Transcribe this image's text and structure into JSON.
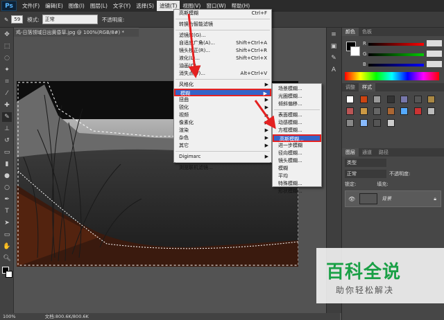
{
  "menubar": {
    "logo": "Ps",
    "items": [
      "文件(F)",
      "编辑(E)",
      "图像(I)",
      "图层(L)",
      "文字(Y)",
      "选择(S)",
      "滤镜(T)",
      "视图(V)",
      "窗口(W)",
      "帮助(H)"
    ]
  },
  "options": {
    "mode_label": "模式:",
    "mode_value": "正常",
    "opacity_label": "不透明度:",
    "size_value": "59"
  },
  "document": {
    "tab_title": "鸡-日落领域日出黄昏草.jpg @ 100%(RGB/8#) *",
    "status": "文档:800.6K/800.6K",
    "zoom": "100%"
  },
  "filter_menu": {
    "items": [
      {
        "label": "高斯模糊",
        "shortcut": "Ctrl+F"
      },
      {
        "label": "转换为智能滤镜",
        "shortcut": ""
      },
      {
        "label": "滤镜库(G)...",
        "shortcut": ""
      },
      {
        "label": "自适应广角(A)...",
        "shortcut": "Shift+Ctrl+A"
      },
      {
        "label": "镜头校正(R)...",
        "shortcut": "Shift+Ctrl+R"
      },
      {
        "label": "液化(L)...",
        "shortcut": "Shift+Ctrl+X"
      },
      {
        "label": "油画(O)...",
        "shortcut": ""
      },
      {
        "label": "消失点(V)...",
        "shortcut": "Alt+Ctrl+V"
      },
      {
        "label": "风格化",
        "shortcut": ""
      },
      {
        "label": "模糊",
        "shortcut": ""
      },
      {
        "label": "扭曲",
        "shortcut": ""
      },
      {
        "label": "锐化",
        "shortcut": ""
      },
      {
        "label": "视频",
        "shortcut": ""
      },
      {
        "label": "像素化",
        "shortcut": ""
      },
      {
        "label": "渲染",
        "shortcut": ""
      },
      {
        "label": "杂色",
        "shortcut": ""
      },
      {
        "label": "其它",
        "shortcut": ""
      },
      {
        "label": "Digimarc",
        "shortcut": ""
      },
      {
        "label": "浏览联机滤镜...",
        "shortcut": ""
      }
    ]
  },
  "blur_submenu": {
    "items": [
      "场景模糊...",
      "光圈模糊...",
      "倾斜偏移...",
      "表面模糊...",
      "动感模糊...",
      "方框模糊...",
      "高斯模糊...",
      "进一步模糊",
      "径向模糊...",
      "镜头模糊...",
      "模糊",
      "平均",
      "特殊模糊...",
      "形状模糊..."
    ]
  },
  "panels": {
    "color_tabs": [
      "颜色",
      "色板"
    ],
    "rgb": [
      "R",
      "G",
      "B"
    ],
    "rgb_values": [
      "",
      "",
      ""
    ],
    "adjust_tabs": [
      "调整",
      "样式"
    ],
    "layer_tabs": [
      "图层",
      "通道",
      "路径"
    ],
    "kind_label": "类型",
    "blend": "正常",
    "opacity_label": "不透明度:",
    "lock_label": "锁定:",
    "fill_label": "填充:",
    "layer_name": "背景"
  },
  "watermark": {
    "title": "百科全说",
    "subtitle": "助你轻松解决"
  },
  "colors": {
    "highlight": "#3464c8",
    "red_box": "#e42121",
    "watermark_green": "#1aa046"
  }
}
